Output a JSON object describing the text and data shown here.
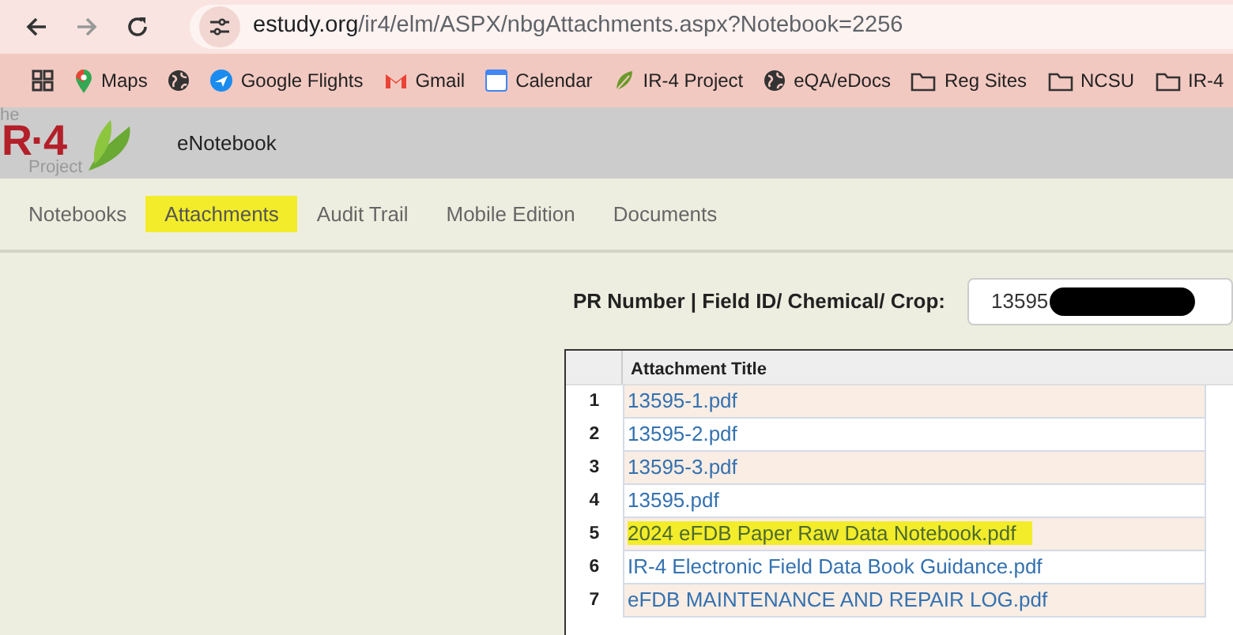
{
  "browser": {
    "url_host": "estudy.org",
    "url_path": "/ir4/elm/ASPX/nbgAttachments.aspx?Notebook=2256",
    "bookmarks": [
      {
        "kind": "apps"
      },
      {
        "kind": "maps",
        "label": "Maps"
      },
      {
        "kind": "globe"
      },
      {
        "kind": "flights",
        "label": "Google Flights"
      },
      {
        "kind": "gmail",
        "label": "Gmail"
      },
      {
        "kind": "calendar",
        "label": "Calendar"
      },
      {
        "kind": "leaf",
        "label": "IR-4 Project"
      },
      {
        "kind": "globe",
        "label": "eQA/eDocs"
      },
      {
        "kind": "folder",
        "label": "Reg Sites"
      },
      {
        "kind": "folder",
        "label": "NCSU"
      },
      {
        "kind": "folder",
        "label": "IR-4"
      }
    ]
  },
  "header": {
    "logo_top": "he",
    "logo_mark": "R·4",
    "logo_bottom": "Project",
    "app_title": "eNotebook"
  },
  "nav": [
    {
      "label": "Notebooks",
      "highlighted": false
    },
    {
      "label": "Attachments",
      "highlighted": true
    },
    {
      "label": "Audit Trail",
      "highlighted": false
    },
    {
      "label": "Mobile Edition",
      "highlighted": false
    },
    {
      "label": "Documents",
      "highlighted": false
    }
  ],
  "filter": {
    "label": "PR Number | Field ID/ Chemical/ Crop:",
    "value": "13595",
    "redacted": true
  },
  "table": {
    "columns": [
      "Attachment Title"
    ],
    "rows": [
      {
        "number": "1",
        "title": "13595-1.pdf",
        "highlighted": false
      },
      {
        "number": "2",
        "title": "13595-2.pdf",
        "highlighted": false
      },
      {
        "number": "3",
        "title": "13595-3.pdf",
        "highlighted": false
      },
      {
        "number": "4",
        "title": "13595.pdf",
        "highlighted": false
      },
      {
        "number": "5",
        "title": "2024 eFDB Paper Raw Data Notebook.pdf",
        "highlighted": true
      },
      {
        "number": "6",
        "title": "IR-4 Electronic Field Data Book Guidance.pdf",
        "highlighted": false
      },
      {
        "number": "7",
        "title": "eFDB MAINTENANCE AND REPAIR LOG.pdf",
        "highlighted": false
      }
    ]
  }
}
